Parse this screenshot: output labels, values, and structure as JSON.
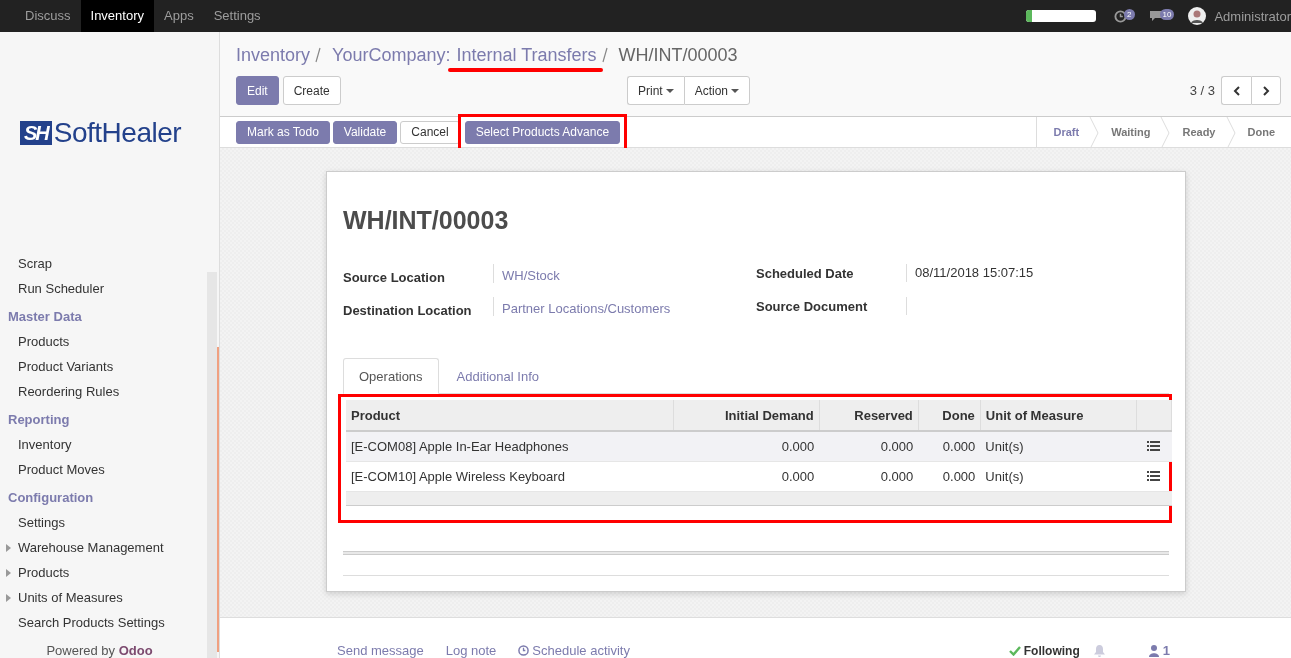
{
  "top_menu": [
    {
      "label": "Discuss",
      "selected": false
    },
    {
      "label": "Inventory",
      "selected": true
    },
    {
      "label": "Apps",
      "selected": false
    },
    {
      "label": "Settings",
      "selected": false
    }
  ],
  "systray": {
    "progress": {
      "level": 0.08
    },
    "activity_count": "2",
    "message_count": "10",
    "user": "Administrator"
  },
  "sidebar": {
    "logo": {
      "mark": "SH",
      "name": "SoftHealer"
    },
    "sections": [
      {
        "items": [
          {
            "label": "Scrap",
            "has_children": false
          },
          {
            "label": "Run Scheduler",
            "has_children": false
          }
        ]
      },
      {
        "title": "Master Data",
        "items": [
          {
            "label": "Products",
            "has_children": false
          },
          {
            "label": "Product Variants",
            "has_children": false
          },
          {
            "label": "Reordering Rules",
            "has_children": false
          }
        ]
      },
      {
        "title": "Reporting",
        "items": [
          {
            "label": "Inventory",
            "has_children": false
          },
          {
            "label": "Product Moves",
            "has_children": false
          }
        ]
      },
      {
        "title": "Configuration",
        "items": [
          {
            "label": "Settings",
            "has_children": false
          },
          {
            "label": "Warehouse Management",
            "has_children": true
          },
          {
            "label": "Products",
            "has_children": true
          },
          {
            "label": "Units of Measures",
            "has_children": true
          },
          {
            "label": "Search Products Settings",
            "has_children": false
          }
        ]
      }
    ],
    "footer": {
      "prefix": "Powered by",
      "brand": "Odoo"
    }
  },
  "breadcrumb": [
    {
      "label": "Inventory",
      "highlighted": false
    },
    {
      "label": "YourCompany:",
      "highlighted": false
    },
    {
      "label": "Internal Transfers",
      "highlighted": true
    },
    {
      "label": "WH/INT/00003",
      "highlighted": false
    }
  ],
  "main_buttons": [
    {
      "label": "Edit",
      "kind": "primary"
    },
    {
      "label": "Create",
      "kind": "secondary"
    }
  ],
  "dropdowns": [
    "Print",
    "Action"
  ],
  "pager": {
    "text": "3 / 3"
  },
  "header_buttons": [
    {
      "label": "Mark as Todo",
      "kind": "primary",
      "highlighted": false
    },
    {
      "label": "Validate",
      "kind": "primary",
      "highlighted": false
    },
    {
      "label": "Cancel",
      "kind": "secondary",
      "highlighted": false
    },
    {
      "label": "Select Products Advance",
      "kind": "primary",
      "highlighted": true
    }
  ],
  "stages": [
    {
      "label": "Draft",
      "selected": true
    },
    {
      "label": "Waiting",
      "selected": false
    },
    {
      "label": "Ready",
      "selected": false
    },
    {
      "label": "Done",
      "selected": false
    }
  ],
  "record": {
    "title": "WH/INT/00003",
    "left_fields": [
      {
        "label": "Source Location",
        "value": "WH/Stock"
      },
      {
        "label": "Destination Location",
        "value": "Partner Locations/Customers"
      }
    ],
    "right_fields": [
      {
        "label": "Scheduled Date",
        "value": "08/11/2018 15:07:15"
      },
      {
        "label": "Source Document"
      }
    ],
    "tabs": [
      {
        "label": "Operations",
        "selected": true
      },
      {
        "label": "Additional Info",
        "selected": false
      }
    ],
    "table": {
      "highlighted": true,
      "columns": [
        {
          "label": "Product",
          "kind": "text"
        },
        {
          "label": "Initial Demand",
          "kind": "number"
        },
        {
          "label": "Reserved",
          "kind": "number"
        },
        {
          "label": "Done",
          "kind": "number"
        },
        {
          "label": "Unit of Measure",
          "kind": "text"
        }
      ],
      "rows": [
        [
          "[E-COM08] Apple In-Ear Headphones",
          "0.000",
          "0.000",
          "0.000",
          "Unit(s)"
        ],
        [
          "[E-COM10] Apple Wireless Keyboard",
          "0.000",
          "0.000",
          "0.000",
          "Unit(s)"
        ]
      ]
    }
  },
  "chatter": {
    "actions": [
      "Send message",
      "Log note",
      "Schedule activity"
    ],
    "following": "Following",
    "followers": "1"
  }
}
